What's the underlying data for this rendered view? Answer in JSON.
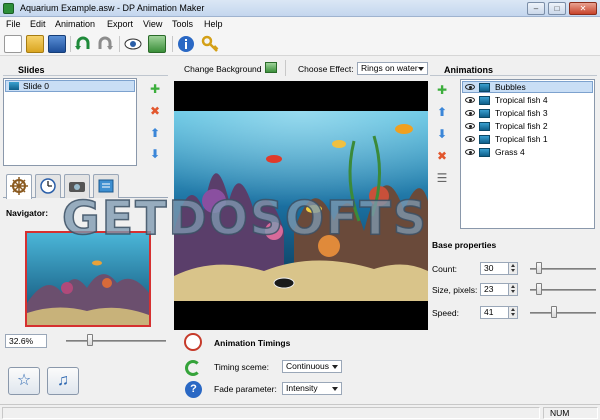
{
  "window": {
    "title": "Aquarium Example.asw - DP Animation Maker"
  },
  "menu": [
    "File",
    "Edit",
    "Animation",
    "Export",
    "View",
    "Tools",
    "Help"
  ],
  "slides": {
    "heading": "Slides",
    "items": [
      "Slide 0"
    ]
  },
  "navigator": {
    "label": "Navigator:",
    "zoom": "32.6%"
  },
  "center": {
    "change_background": "Change Background",
    "choose_effect_label": "Choose Effect:",
    "effect_value": "Rings on water"
  },
  "timings": {
    "heading": "Animation Timings",
    "timing_label": "Timing sceme:",
    "timing_value": "Continuous",
    "fade_label": "Fade parameter:",
    "fade_value": "Intensity"
  },
  "animations": {
    "heading": "Animations",
    "items": [
      "Bubbles",
      "Tropical fish 4",
      "Tropical fish 3",
      "Tropical fish 2",
      "Tropical fish 1",
      "Grass 4"
    ]
  },
  "base_properties": {
    "heading": "Base properties",
    "count_label": "Count:",
    "count_value": "30",
    "size_label": "Size, pixels:",
    "size_value": "23",
    "speed_label": "Speed:",
    "speed_value": "41"
  },
  "statusbar": {
    "num": "NUM"
  },
  "watermark": "GETDOSOFTS",
  "colors": {
    "selection": "#c9def5",
    "accent_red": "#d63030",
    "water": "#1a6fa0"
  }
}
